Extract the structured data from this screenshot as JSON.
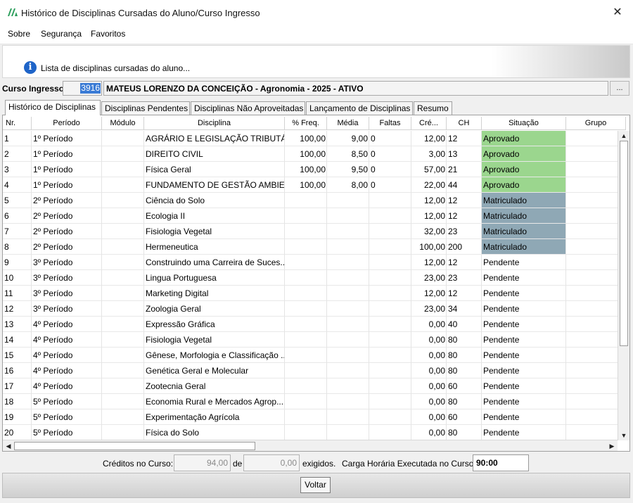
{
  "window": {
    "title": "Histórico de Disciplinas Cursadas do Aluno/Curso Ingresso",
    "close_symbol": "✕",
    "icon": "app-logo-icon"
  },
  "menu": {
    "items": [
      "Sobre",
      "Segurança",
      "Favoritos"
    ]
  },
  "info": {
    "icon": "info-icon",
    "text": "Lista de disciplinas cursadas do aluno..."
  },
  "curso": {
    "label": "Curso Ingresso:",
    "code": "3916",
    "description": "MATEUS LORENZO DA CONCEIÇÃO - Agronomia - 2025 - ATIVO",
    "lookup_label": "..."
  },
  "tabs": [
    "Histórico de Disciplinas",
    "Disciplinas Pendentes",
    "Disciplinas Não Aproveitadas",
    "Lançamento de Disciplinas",
    "Resumo"
  ],
  "table": {
    "headers": [
      "Nr.",
      "Período",
      "Módulo",
      "Disciplina",
      "% Freq.",
      "Média",
      "Faltas",
      "Cré...",
      "CH",
      "Situação",
      "Grupo"
    ],
    "rows": [
      {
        "nr": "1",
        "periodo": "1º Período",
        "modulo": "",
        "disciplina": "AGRÁRIO E LEGISLAÇÃO TRIBUTÁRIA",
        "freq": "100,00",
        "media": "9,00",
        "faltas": "0",
        "creditos": "12,00",
        "ch": "12",
        "situacao": "Aprovado",
        "grupo": ""
      },
      {
        "nr": "2",
        "periodo": "1º Período",
        "modulo": "",
        "disciplina": "DIREITO CIVIL",
        "freq": "100,00",
        "media": "8,50",
        "faltas": "0",
        "creditos": "3,00",
        "ch": "13",
        "situacao": "Aprovado",
        "grupo": ""
      },
      {
        "nr": "3",
        "periodo": "1º Período",
        "modulo": "",
        "disciplina": "Física Geral",
        "freq": "100,00",
        "media": "9,50",
        "faltas": "0",
        "creditos": "57,00",
        "ch": "21",
        "situacao": "Aprovado",
        "grupo": ""
      },
      {
        "nr": "4",
        "periodo": "1º Período",
        "modulo": "",
        "disciplina": "FUNDAMENTO DE GESTÃO AMBIE...",
        "freq": "100,00",
        "media": "8,00",
        "faltas": "0",
        "creditos": "22,00",
        "ch": "44",
        "situacao": "Aprovado",
        "grupo": ""
      },
      {
        "nr": "5",
        "periodo": "2º Período",
        "modulo": "",
        "disciplina": "Ciência do Solo",
        "freq": "",
        "media": "",
        "faltas": "",
        "creditos": "12,00",
        "ch": "12",
        "situacao": "Matriculado",
        "grupo": ""
      },
      {
        "nr": "6",
        "periodo": "2º Período",
        "modulo": "",
        "disciplina": "Ecologia II",
        "freq": "",
        "media": "",
        "faltas": "",
        "creditos": "12,00",
        "ch": "12",
        "situacao": "Matriculado",
        "grupo": ""
      },
      {
        "nr": "7",
        "periodo": "2º Período",
        "modulo": "",
        "disciplina": "Fisiologia Vegetal",
        "freq": "",
        "media": "",
        "faltas": "",
        "creditos": "32,00",
        "ch": "23",
        "situacao": "Matriculado",
        "grupo": ""
      },
      {
        "nr": "8",
        "periodo": "2º Período",
        "modulo": "",
        "disciplina": "Hermeneutica",
        "freq": "",
        "media": "",
        "faltas": "",
        "creditos": "100,00",
        "ch": "200",
        "situacao": "Matriculado",
        "grupo": ""
      },
      {
        "nr": "9",
        "periodo": "3º Período",
        "modulo": "",
        "disciplina": "Construindo uma Carreira de Suces...",
        "freq": "",
        "media": "",
        "faltas": "",
        "creditos": "12,00",
        "ch": "12",
        "situacao": "Pendente",
        "grupo": ""
      },
      {
        "nr": "10",
        "periodo": "3º Período",
        "modulo": "",
        "disciplina": "Lingua Portuguesa",
        "freq": "",
        "media": "",
        "faltas": "",
        "creditos": "23,00",
        "ch": "23",
        "situacao": "Pendente",
        "grupo": ""
      },
      {
        "nr": "11",
        "periodo": "3º Período",
        "modulo": "",
        "disciplina": "Marketing Digital",
        "freq": "",
        "media": "",
        "faltas": "",
        "creditos": "12,00",
        "ch": "12",
        "situacao": "Pendente",
        "grupo": ""
      },
      {
        "nr": "12",
        "periodo": "3º Período",
        "modulo": "",
        "disciplina": "Zoologia Geral",
        "freq": "",
        "media": "",
        "faltas": "",
        "creditos": "23,00",
        "ch": "34",
        "situacao": "Pendente",
        "grupo": ""
      },
      {
        "nr": "13",
        "periodo": "4º Período",
        "modulo": "",
        "disciplina": "Expressão Gráfica",
        "freq": "",
        "media": "",
        "faltas": "",
        "creditos": "0,00",
        "ch": "40",
        "situacao": "Pendente",
        "grupo": ""
      },
      {
        "nr": "14",
        "periodo": "4º Período",
        "modulo": "",
        "disciplina": "Fisiologia Vegetal",
        "freq": "",
        "media": "",
        "faltas": "",
        "creditos": "0,00",
        "ch": "80",
        "situacao": "Pendente",
        "grupo": ""
      },
      {
        "nr": "15",
        "periodo": "4º Período",
        "modulo": "",
        "disciplina": "Gênese, Morfologia e Classificação ...",
        "freq": "",
        "media": "",
        "faltas": "",
        "creditos": "0,00",
        "ch": "80",
        "situacao": "Pendente",
        "grupo": ""
      },
      {
        "nr": "16",
        "periodo": "4º Período",
        "modulo": "",
        "disciplina": "Genética Geral e Molecular",
        "freq": "",
        "media": "",
        "faltas": "",
        "creditos": "0,00",
        "ch": "80",
        "situacao": "Pendente",
        "grupo": ""
      },
      {
        "nr": "17",
        "periodo": "4º Período",
        "modulo": "",
        "disciplina": "Zootecnia Geral",
        "freq": "",
        "media": "",
        "faltas": "",
        "creditos": "0,00",
        "ch": "60",
        "situacao": "Pendente",
        "grupo": ""
      },
      {
        "nr": "18",
        "periodo": "5º Período",
        "modulo": "",
        "disciplina": "Economia Rural e Mercados Agrop...",
        "freq": "",
        "media": "",
        "faltas": "",
        "creditos": "0,00",
        "ch": "80",
        "situacao": "Pendente",
        "grupo": ""
      },
      {
        "nr": "19",
        "periodo": "5º Período",
        "modulo": "",
        "disciplina": "Experimentação Agrícola",
        "freq": "",
        "media": "",
        "faltas": "",
        "creditos": "0,00",
        "ch": "60",
        "situacao": "Pendente",
        "grupo": ""
      },
      {
        "nr": "20",
        "periodo": "5º Período",
        "modulo": "",
        "disciplina": "Física do Solo",
        "freq": "",
        "media": "",
        "faltas": "",
        "creditos": "0,00",
        "ch": "80",
        "situacao": "Pendente",
        "grupo": ""
      }
    ]
  },
  "colors": {
    "aprovado": "#9bd68e",
    "matriculado": "#8fa8b5",
    "selection": "#3a7bd5",
    "info_icon": "#1e64c8"
  },
  "footer": {
    "creditos_label": "Créditos no Curso:",
    "creditos_value": "94,00",
    "de_label": "de",
    "exigidos_value": "0,00",
    "exigidos_label": "exigidos.",
    "carga_label": "Carga Horária Executada no Curso:",
    "carga_value": "90:00"
  },
  "buttons": {
    "voltar": "Voltar"
  }
}
